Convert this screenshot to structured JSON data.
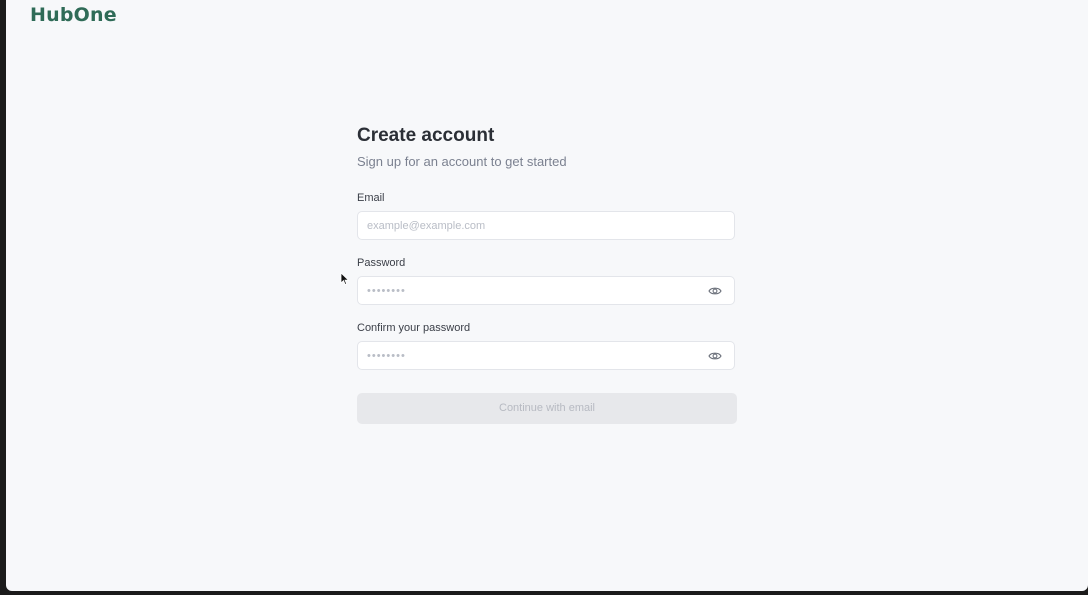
{
  "brand": {
    "logo_text": "HubOne",
    "color": "#2f6b57"
  },
  "form": {
    "title": "Create account",
    "subtitle": "Sign up for an account to get started",
    "email": {
      "label": "Email",
      "placeholder": "example@example.com",
      "value": ""
    },
    "password": {
      "label": "Password",
      "placeholder": "••••••••",
      "value": "",
      "toggle_icon": "eye-icon"
    },
    "confirm_password": {
      "label": "Confirm your password",
      "placeholder": "••••••••",
      "value": "",
      "toggle_icon": "eye-icon"
    },
    "submit_label": "Continue with email",
    "submit_enabled": false
  },
  "colors": {
    "background": "#f7f8fa",
    "text_primary": "#2b2f36",
    "text_muted": "#7b8190",
    "button_disabled_bg": "#e7e8eb",
    "button_disabled_text": "#b7bac2"
  }
}
